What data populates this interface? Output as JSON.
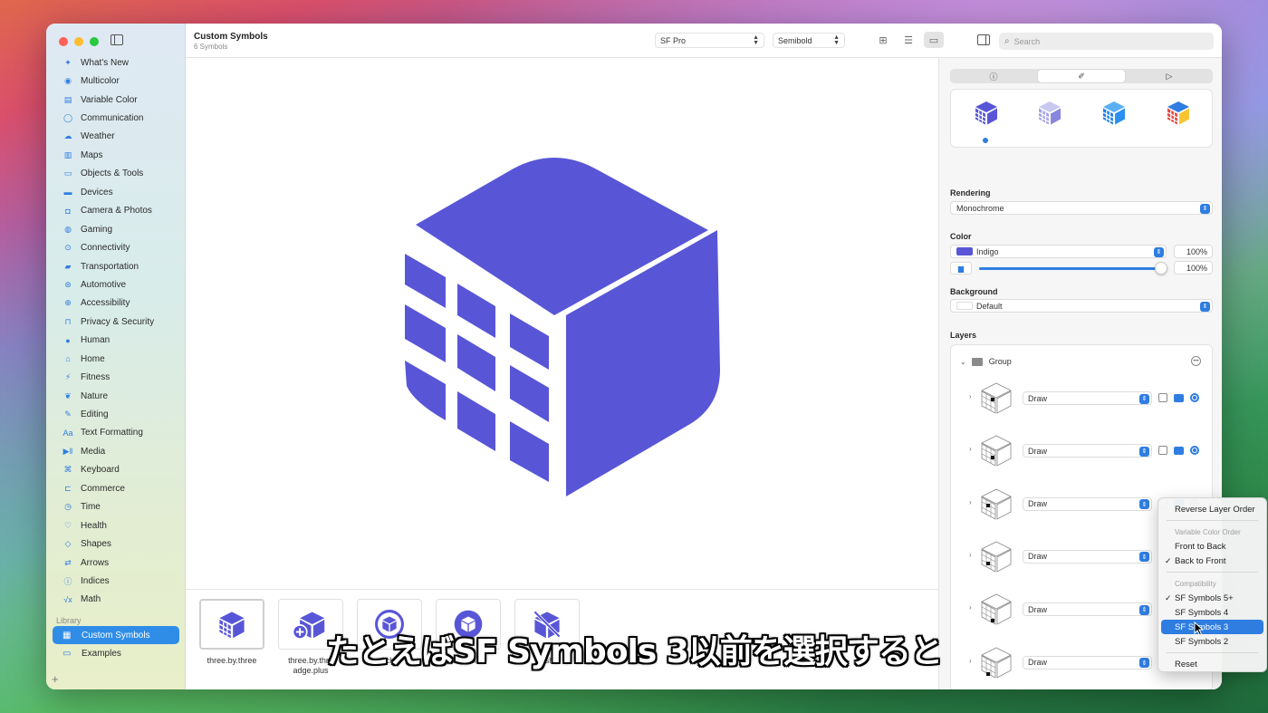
{
  "colors": {
    "accent": "#2f7de1",
    "indigo": "#5856d6",
    "selection": "#2f8de8"
  },
  "toolbar": {
    "title": "Custom Symbols",
    "subtitle": "6 Symbols",
    "font": "SF Pro",
    "weight": "Semibold",
    "search_placeholder": "Search"
  },
  "sidebar": {
    "categories": [
      {
        "label": "What's New",
        "icon": "sparkle-icon"
      },
      {
        "label": "Multicolor",
        "icon": "palette-icon"
      },
      {
        "label": "Variable Color",
        "icon": "variable-icon"
      },
      {
        "label": "Communication",
        "icon": "bubble-icon"
      },
      {
        "label": "Weather",
        "icon": "cloud-sun-icon"
      },
      {
        "label": "Maps",
        "icon": "map-icon"
      },
      {
        "label": "Objects & Tools",
        "icon": "folder-icon"
      },
      {
        "label": "Devices",
        "icon": "display-icon"
      },
      {
        "label": "Camera & Photos",
        "icon": "camera-icon"
      },
      {
        "label": "Gaming",
        "icon": "gamecontroller-icon"
      },
      {
        "label": "Connectivity",
        "icon": "antenna-icon"
      },
      {
        "label": "Transportation",
        "icon": "car-icon"
      },
      {
        "label": "Automotive",
        "icon": "steering-wheel-icon"
      },
      {
        "label": "Accessibility",
        "icon": "accessibility-icon"
      },
      {
        "label": "Privacy & Security",
        "icon": "lock-icon"
      },
      {
        "label": "Human",
        "icon": "person-icon"
      },
      {
        "label": "Home",
        "icon": "house-icon"
      },
      {
        "label": "Fitness",
        "icon": "figure-run-icon"
      },
      {
        "label": "Nature",
        "icon": "leaf-icon"
      },
      {
        "label": "Editing",
        "icon": "pencil-icon"
      },
      {
        "label": "Text Formatting",
        "icon": "textformat-icon"
      },
      {
        "label": "Media",
        "icon": "playpause-icon"
      },
      {
        "label": "Keyboard",
        "icon": "command-icon"
      },
      {
        "label": "Commerce",
        "icon": "cart-icon"
      },
      {
        "label": "Time",
        "icon": "clock-icon"
      },
      {
        "label": "Health",
        "icon": "heart-icon"
      },
      {
        "label": "Shapes",
        "icon": "shapes-icon"
      },
      {
        "label": "Arrows",
        "icon": "arrows-icon"
      },
      {
        "label": "Indices",
        "icon": "indices-icon"
      },
      {
        "label": "Math",
        "icon": "sqrt-icon"
      }
    ],
    "library_label": "Library",
    "library_items": [
      {
        "label": "Custom Symbols",
        "icon": "grid-icon",
        "selected": true
      },
      {
        "label": "Examples",
        "icon": "folder-icon",
        "selected": false
      }
    ]
  },
  "gallery": {
    "items": [
      {
        "label": "three.by.three",
        "selected": true
      },
      {
        "label": "three.by.three.badge.plus",
        "shown": "three.by.thre\nadge.plus"
      },
      {
        "label": "rcle"
      },
      {
        "label": "rcle.fill"
      },
      {
        "label": "ash"
      }
    ]
  },
  "inspector": {
    "rendering_label": "Rendering",
    "rendering_value": "Monochrome",
    "color_label": "Color",
    "color_value": "Indigo",
    "color_pct": "100%",
    "opacity_pct": "100%",
    "opacity_level": 1.0,
    "background_label": "Background",
    "background_value": "Default",
    "layers_label": "Layers",
    "group_label": "Group",
    "layers": [
      {
        "mode": "Draw"
      },
      {
        "mode": "Draw"
      },
      {
        "mode": "Draw"
      },
      {
        "mode": "Draw"
      },
      {
        "mode": "Draw"
      },
      {
        "mode": "Draw"
      }
    ]
  },
  "menu": {
    "reverse": "Reverse Layer Order",
    "vco_header": "Variable Color Order",
    "front_to_back": "Front to Back",
    "back_to_front": "Back to Front",
    "compat_header": "Compatibility",
    "sf5": "SF Symbols 5+",
    "sf4": "SF Symbols 4",
    "sf3": "SF Symbols 3",
    "sf2": "SF Symbols 2",
    "reset": "Reset"
  },
  "subtitle": "たとえばSF Symbols 3以前を選択すると"
}
